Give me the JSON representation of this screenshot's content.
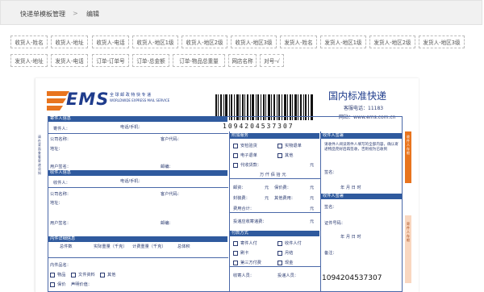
{
  "breadcrumb": {
    "root": "快递单模板管理",
    "sep": ">",
    "current": "编辑"
  },
  "field_tags": [
    "收货人-姓名",
    "收货人-地址",
    "收货人-电话",
    "收货人-地区1级",
    "收货人-地区2级",
    "收货人-地区3级",
    "发货人-姓名",
    "发货人-地区1级",
    "发货人-地区2级",
    "发货人-地区3级",
    "发货人-地址",
    "发货人-电话",
    "订单-订单号",
    "订单-总金额",
    "订单-物品总重量",
    "网店名称",
    "对号-√"
  ],
  "waybill": {
    "logo_text": "EMS",
    "logo_cn": "全 球 邮 政 特 快 专 递",
    "logo_en": "WORLDWIDE EXPRESS MAIL SERVICE",
    "barcode_number": "1094204537307",
    "title": "国内标准快递",
    "hotline": "客服电话：11183",
    "website": "网站：www.ems.com.cn",
    "sender_section": "寄件人信息",
    "sender_name": "寄件人：",
    "phone_label": "电话/手机：",
    "company": "公司名称：",
    "customer_code": "客户代码：",
    "address": "地址：",
    "user_code": "用户签名：",
    "postcode": "邮编：",
    "recipient_section": "收件人信息",
    "recipient_name": "收件人：",
    "cargo_section": "内件详细信息",
    "pieces": "总件数",
    "actual_weight": "实际重量（千克）",
    "charge_weight": "计费重量（千克）",
    "volume": "总体积",
    "item_name": "内件品名：",
    "item_types": [
      "物品",
      "文件资料",
      "其他"
    ],
    "insured": "保价",
    "declared_value": "声明价值：",
    "service_section": "附加服务",
    "services": [
      "安检验货",
      "实物退单",
      "电子退单",
      "其他",
      "代收货款："
    ],
    "amount_label": "万 仟 佰 拾 元",
    "fees": [
      "邮资：",
      "保价费：",
      "封装费：",
      "其他费用：",
      "费用合计：",
      "投递应收寄递费："
    ],
    "yuan": "元",
    "payment_section": "付款方式",
    "payments": [
      "寄件人付",
      "收件人付",
      "刷卡",
      "月结",
      "第三方付费",
      "现金"
    ],
    "receiver_section": "收件人签署",
    "receiver_note": "请收件人阅读寄件人填写的全部内容，确认寄递物品完好后再签收，否则视为已收到",
    "sign_label": "签名：",
    "date_label": "年 月 日 时",
    "id_label": "证件号码：",
    "remarks": "备注：",
    "dispatcher": "收寄人员：",
    "deliverer": "投递人员：",
    "bottom_number": "1094204537307",
    "side_tabs": [
      "收件人存根",
      "寄件人存根"
    ],
    "warning": "请在背面查看寄递须知"
  },
  "colors": {
    "ems_orange": "#e8741e",
    "ems_blue": "#1f3c8c",
    "section_blue": "#2f5a9e"
  }
}
